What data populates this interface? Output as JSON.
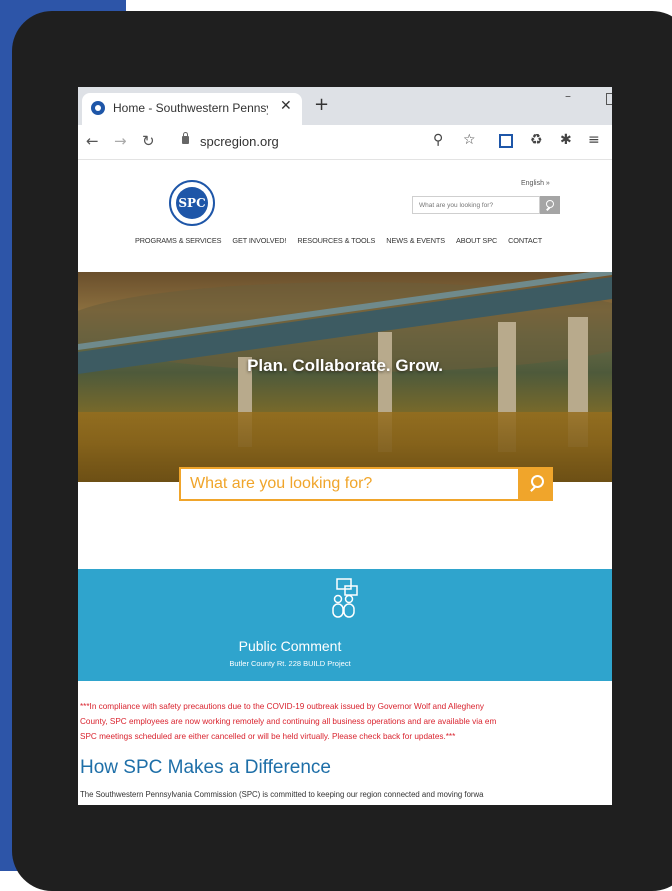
{
  "browser": {
    "tab_title": "Home - Southwestern Pennsylvania",
    "tab_close": "✕",
    "new_tab": "+",
    "url": "spcregion.org"
  },
  "site": {
    "logo_text": "SPC",
    "language": "English",
    "header_search_placeholder": "What are you looking for?",
    "nav": [
      "PROGRAMS & SERVICES",
      "GET INVOLVED!",
      "RESOURCES & TOOLS",
      "NEWS & EVENTS",
      "ABOUT SPC",
      "CONTACT"
    ]
  },
  "hero": {
    "title": "Plan. Collaborate. Grow.",
    "search_placeholder": "What are you looking for?"
  },
  "public_comment": {
    "title": "Public Comment",
    "subtitle": "Butler County Rt. 228 BUILD Project"
  },
  "notice": {
    "line1": "***In compliance with safety precautions due to the COVID-19 outbreak issued by Governor Wolf and Allegheny",
    "line2": "County, SPC employees are now working remotely and continuing all business operations and are available via em",
    "line3": "SPC meetings scheduled are either cancelled or will be held virtually.  Please check back for updates.***"
  },
  "section": {
    "title": "How SPC Makes a Difference",
    "body": "The Southwestern Pennsylvania Commission (SPC) is committed to keeping our region connected and moving forwa"
  },
  "colors": {
    "brand_blue": "#1e56a8",
    "accent_orange": "#f0a52b",
    "band_teal": "#2fa4cd",
    "notice_red": "#d9232e",
    "outer_blue": "#2d55a8",
    "device_black": "#1f1f1f"
  },
  "icons": {
    "favicon": "spc-favicon-icon",
    "back": "back-arrow-icon",
    "forward": "forward-arrow-icon",
    "reload": "reload-icon",
    "lock": "lock-icon",
    "zoom": "zoom-icon",
    "bookmark": "star-icon",
    "extensions": "puzzle-icon",
    "public_comment": "people-chat-icon"
  }
}
